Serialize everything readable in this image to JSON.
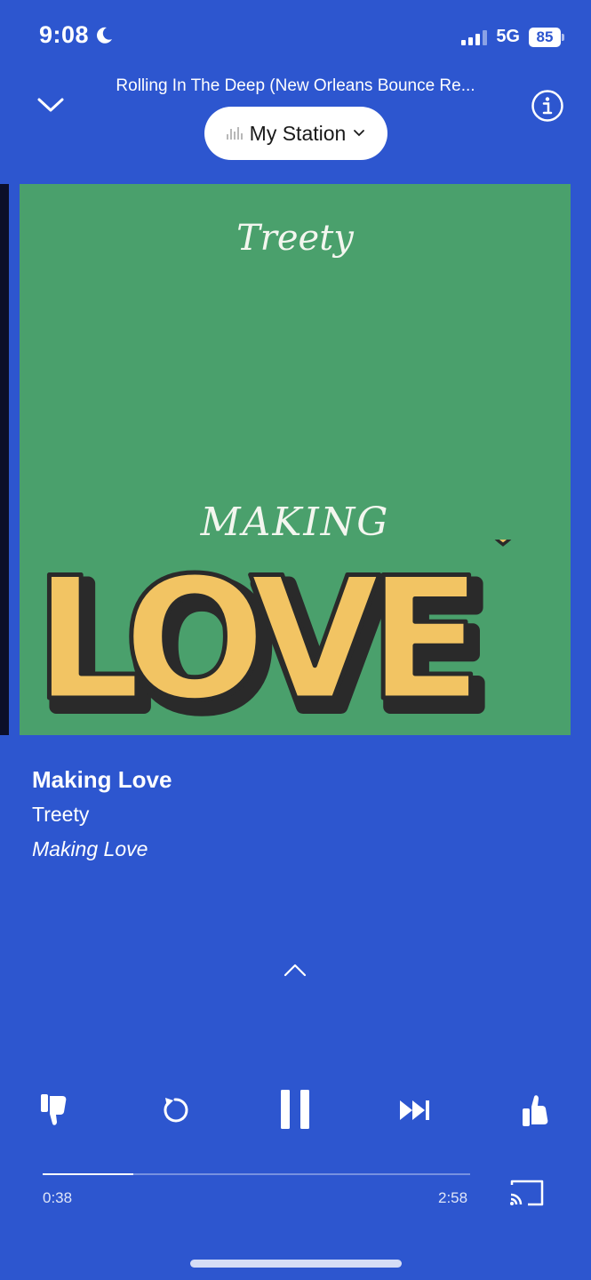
{
  "status_bar": {
    "time": "9:08",
    "network": "5G",
    "battery": "85",
    "icons": [
      "moon-icon",
      "signal-icon",
      "battery-icon"
    ]
  },
  "header": {
    "now_playing_title": "Rolling In The Deep (New Orleans Bounce Re...",
    "station_label": "My Station",
    "icons": [
      "chevron-down-icon",
      "info-icon",
      "equalizer-icon"
    ]
  },
  "album_art": {
    "artist_text": "Treety",
    "title_top": "MAKING",
    "title_big": "LOVE",
    "colors": {
      "background": "#4aa06c",
      "letters": "#f2c463",
      "outline": "#2a2a2a"
    }
  },
  "track": {
    "title": "Making Love",
    "artist": "Treety",
    "album": "Making Love"
  },
  "controls": {
    "icons": [
      "thumbs-down-icon",
      "replay-icon",
      "pause-icon",
      "skip-forward-icon",
      "thumbs-up-icon",
      "cast-icon",
      "chevron-up-icon"
    ]
  },
  "playback": {
    "elapsed": "0:38",
    "duration": "2:58",
    "progress_fraction": 0.213
  },
  "theme": {
    "background": "#2d56cf",
    "text": "#ffffff"
  }
}
